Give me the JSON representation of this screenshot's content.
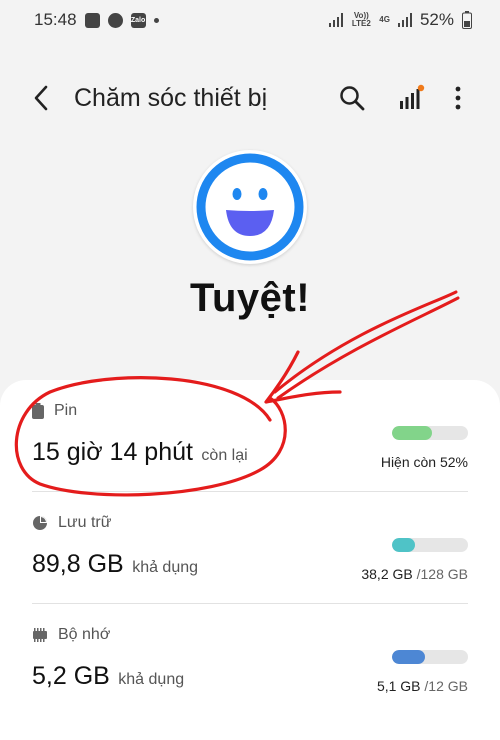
{
  "status_bar": {
    "time": "15:48",
    "notif_icons": [
      "image-icon",
      "messenger-icon",
      "zalo-icon"
    ],
    "zalo_label": "Zalo",
    "lte_label": "Vo)) LTE2",
    "net_label": "4G",
    "battery": "52%"
  },
  "app_bar": {
    "title": "Chăm sóc thiết bị"
  },
  "main": {
    "headline": "Tuyệt!",
    "face_color": "#1e87f0",
    "face_mouth_color": "#5b5ff1"
  },
  "items": [
    {
      "label": "Pin",
      "icon": "battery-icon",
      "value": "15 giờ 14 phút",
      "suffix": "còn lại",
      "caption_main": "Hiện còn 52%",
      "caption_sub": "",
      "fill_fraction": 0.52,
      "color": "#82d48a"
    },
    {
      "label": "Lưu trữ",
      "icon": "pie-chart-icon",
      "value": "89,8 GB",
      "suffix": "khả dụng",
      "caption_main": "38,2 GB",
      "caption_sub": " /128 GB",
      "fill_fraction": 0.3,
      "color": "#4fc3c7"
    },
    {
      "label": "Bộ nhớ",
      "icon": "memory-chip-icon",
      "value": "5,2 GB",
      "suffix": "khả dụng",
      "caption_main": "5,1 GB",
      "caption_sub": " /12 GB",
      "fill_fraction": 0.43,
      "color": "#4d87d4"
    }
  ],
  "annotation_color": "#e41c1c"
}
